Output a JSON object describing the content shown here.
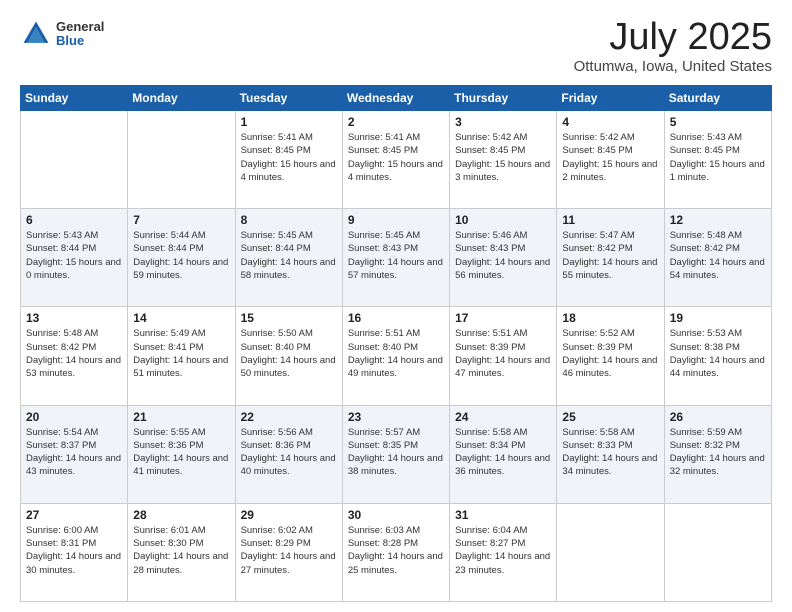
{
  "logo": {
    "general": "General",
    "blue": "Blue"
  },
  "title": "July 2025",
  "location": "Ottumwa, Iowa, United States",
  "weekdays": [
    "Sunday",
    "Monday",
    "Tuesday",
    "Wednesday",
    "Thursday",
    "Friday",
    "Saturday"
  ],
  "weeks": [
    [
      {
        "day": "",
        "sunrise": "",
        "sunset": "",
        "daylight": ""
      },
      {
        "day": "",
        "sunrise": "",
        "sunset": "",
        "daylight": ""
      },
      {
        "day": "1",
        "sunrise": "Sunrise: 5:41 AM",
        "sunset": "Sunset: 8:45 PM",
        "daylight": "Daylight: 15 hours and 4 minutes."
      },
      {
        "day": "2",
        "sunrise": "Sunrise: 5:41 AM",
        "sunset": "Sunset: 8:45 PM",
        "daylight": "Daylight: 15 hours and 4 minutes."
      },
      {
        "day": "3",
        "sunrise": "Sunrise: 5:42 AM",
        "sunset": "Sunset: 8:45 PM",
        "daylight": "Daylight: 15 hours and 3 minutes."
      },
      {
        "day": "4",
        "sunrise": "Sunrise: 5:42 AM",
        "sunset": "Sunset: 8:45 PM",
        "daylight": "Daylight: 15 hours and 2 minutes."
      },
      {
        "day": "5",
        "sunrise": "Sunrise: 5:43 AM",
        "sunset": "Sunset: 8:45 PM",
        "daylight": "Daylight: 15 hours and 1 minute."
      }
    ],
    [
      {
        "day": "6",
        "sunrise": "Sunrise: 5:43 AM",
        "sunset": "Sunset: 8:44 PM",
        "daylight": "Daylight: 15 hours and 0 minutes."
      },
      {
        "day": "7",
        "sunrise": "Sunrise: 5:44 AM",
        "sunset": "Sunset: 8:44 PM",
        "daylight": "Daylight: 14 hours and 59 minutes."
      },
      {
        "day": "8",
        "sunrise": "Sunrise: 5:45 AM",
        "sunset": "Sunset: 8:44 PM",
        "daylight": "Daylight: 14 hours and 58 minutes."
      },
      {
        "day": "9",
        "sunrise": "Sunrise: 5:45 AM",
        "sunset": "Sunset: 8:43 PM",
        "daylight": "Daylight: 14 hours and 57 minutes."
      },
      {
        "day": "10",
        "sunrise": "Sunrise: 5:46 AM",
        "sunset": "Sunset: 8:43 PM",
        "daylight": "Daylight: 14 hours and 56 minutes."
      },
      {
        "day": "11",
        "sunrise": "Sunrise: 5:47 AM",
        "sunset": "Sunset: 8:42 PM",
        "daylight": "Daylight: 14 hours and 55 minutes."
      },
      {
        "day": "12",
        "sunrise": "Sunrise: 5:48 AM",
        "sunset": "Sunset: 8:42 PM",
        "daylight": "Daylight: 14 hours and 54 minutes."
      }
    ],
    [
      {
        "day": "13",
        "sunrise": "Sunrise: 5:48 AM",
        "sunset": "Sunset: 8:42 PM",
        "daylight": "Daylight: 14 hours and 53 minutes."
      },
      {
        "day": "14",
        "sunrise": "Sunrise: 5:49 AM",
        "sunset": "Sunset: 8:41 PM",
        "daylight": "Daylight: 14 hours and 51 minutes."
      },
      {
        "day": "15",
        "sunrise": "Sunrise: 5:50 AM",
        "sunset": "Sunset: 8:40 PM",
        "daylight": "Daylight: 14 hours and 50 minutes."
      },
      {
        "day": "16",
        "sunrise": "Sunrise: 5:51 AM",
        "sunset": "Sunset: 8:40 PM",
        "daylight": "Daylight: 14 hours and 49 minutes."
      },
      {
        "day": "17",
        "sunrise": "Sunrise: 5:51 AM",
        "sunset": "Sunset: 8:39 PM",
        "daylight": "Daylight: 14 hours and 47 minutes."
      },
      {
        "day": "18",
        "sunrise": "Sunrise: 5:52 AM",
        "sunset": "Sunset: 8:39 PM",
        "daylight": "Daylight: 14 hours and 46 minutes."
      },
      {
        "day": "19",
        "sunrise": "Sunrise: 5:53 AM",
        "sunset": "Sunset: 8:38 PM",
        "daylight": "Daylight: 14 hours and 44 minutes."
      }
    ],
    [
      {
        "day": "20",
        "sunrise": "Sunrise: 5:54 AM",
        "sunset": "Sunset: 8:37 PM",
        "daylight": "Daylight: 14 hours and 43 minutes."
      },
      {
        "day": "21",
        "sunrise": "Sunrise: 5:55 AM",
        "sunset": "Sunset: 8:36 PM",
        "daylight": "Daylight: 14 hours and 41 minutes."
      },
      {
        "day": "22",
        "sunrise": "Sunrise: 5:56 AM",
        "sunset": "Sunset: 8:36 PM",
        "daylight": "Daylight: 14 hours and 40 minutes."
      },
      {
        "day": "23",
        "sunrise": "Sunrise: 5:57 AM",
        "sunset": "Sunset: 8:35 PM",
        "daylight": "Daylight: 14 hours and 38 minutes."
      },
      {
        "day": "24",
        "sunrise": "Sunrise: 5:58 AM",
        "sunset": "Sunset: 8:34 PM",
        "daylight": "Daylight: 14 hours and 36 minutes."
      },
      {
        "day": "25",
        "sunrise": "Sunrise: 5:58 AM",
        "sunset": "Sunset: 8:33 PM",
        "daylight": "Daylight: 14 hours and 34 minutes."
      },
      {
        "day": "26",
        "sunrise": "Sunrise: 5:59 AM",
        "sunset": "Sunset: 8:32 PM",
        "daylight": "Daylight: 14 hours and 32 minutes."
      }
    ],
    [
      {
        "day": "27",
        "sunrise": "Sunrise: 6:00 AM",
        "sunset": "Sunset: 8:31 PM",
        "daylight": "Daylight: 14 hours and 30 minutes."
      },
      {
        "day": "28",
        "sunrise": "Sunrise: 6:01 AM",
        "sunset": "Sunset: 8:30 PM",
        "daylight": "Daylight: 14 hours and 28 minutes."
      },
      {
        "day": "29",
        "sunrise": "Sunrise: 6:02 AM",
        "sunset": "Sunset: 8:29 PM",
        "daylight": "Daylight: 14 hours and 27 minutes."
      },
      {
        "day": "30",
        "sunrise": "Sunrise: 6:03 AM",
        "sunset": "Sunset: 8:28 PM",
        "daylight": "Daylight: 14 hours and 25 minutes."
      },
      {
        "day": "31",
        "sunrise": "Sunrise: 6:04 AM",
        "sunset": "Sunset: 8:27 PM",
        "daylight": "Daylight: 14 hours and 23 minutes."
      },
      {
        "day": "",
        "sunrise": "",
        "sunset": "",
        "daylight": ""
      },
      {
        "day": "",
        "sunrise": "",
        "sunset": "",
        "daylight": ""
      }
    ]
  ]
}
